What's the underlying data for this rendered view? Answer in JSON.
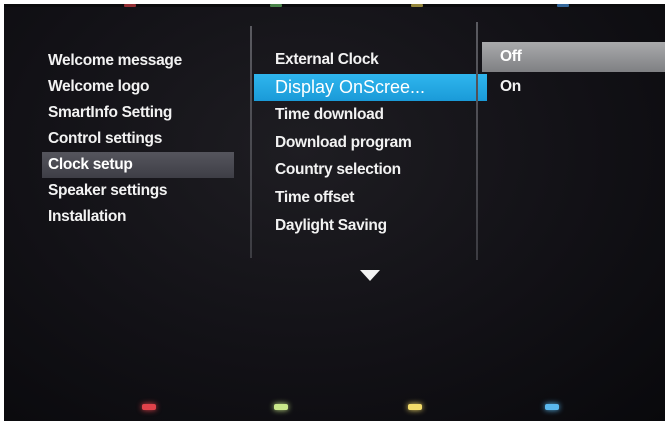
{
  "left_menu": {
    "items": [
      {
        "label": "Welcome message"
      },
      {
        "label": "Welcome logo"
      },
      {
        "label": "SmartInfo Setting"
      },
      {
        "label": "Control settings"
      },
      {
        "label": "Clock setup"
      },
      {
        "label": "Speaker settings"
      },
      {
        "label": "Installation"
      }
    ],
    "selected_index": 4
  },
  "middle_menu": {
    "items": [
      {
        "label": "External Clock"
      },
      {
        "label": "Display OnScree..."
      },
      {
        "label": "Time download"
      },
      {
        "label": "Download program"
      },
      {
        "label": "Country selection"
      },
      {
        "label": "Time offset"
      },
      {
        "label": "Daylight Saving"
      }
    ],
    "focused_index": 1,
    "more_indicator": "down-arrow-icon"
  },
  "right_menu": {
    "items": [
      {
        "label": "Off"
      },
      {
        "label": "On"
      }
    ],
    "selected_index": 0
  },
  "color_keys": [
    {
      "name": "red",
      "color": "#e0424a"
    },
    {
      "name": "green",
      "color": "#c9e88a"
    },
    {
      "name": "yellow",
      "color": "#f3dc6a"
    },
    {
      "name": "blue",
      "color": "#5ab8ee"
    }
  ],
  "colors": {
    "focus_blue": "#1fa4e0",
    "selection_grey": "#4a4a52",
    "option_selected_grey": "#919294",
    "background": "#141318"
  }
}
